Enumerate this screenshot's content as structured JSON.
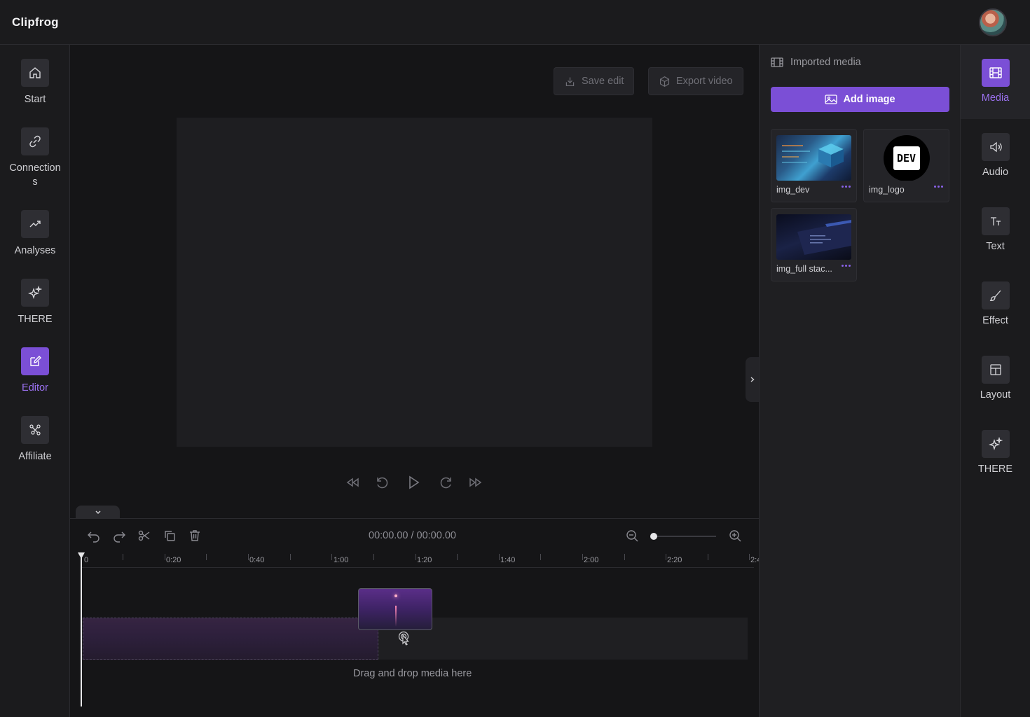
{
  "app": {
    "name": "Clipfrog"
  },
  "left_nav": [
    {
      "label": "Start",
      "icon": "home-icon"
    },
    {
      "label": "Connections",
      "icon": "link-icon"
    },
    {
      "label": "Analyses",
      "icon": "trend-icon"
    },
    {
      "label": "THERE",
      "icon": "sparkle-icon"
    },
    {
      "label": "Editor",
      "icon": "edit-icon",
      "active": true
    },
    {
      "label": "Affiliate",
      "icon": "network-icon"
    }
  ],
  "stage": {
    "save_label": "Save edit",
    "export_label": "Export video"
  },
  "timeline": {
    "time_readout": "00:00.00 / 00:00.00",
    "ruler_labels": [
      "0",
      "0:20",
      "0:40",
      "1:00",
      "1:20",
      "1:40",
      "2:00",
      "2:20",
      "2:4"
    ],
    "drop_hint": "Drag and drop media here"
  },
  "media_panel": {
    "title": "Imported media",
    "add_label": "Add image",
    "items": [
      {
        "name": "img_dev"
      },
      {
        "name": "img_logo",
        "logo_text": "DEV"
      },
      {
        "name": "img_full stac..."
      }
    ]
  },
  "right_nav": [
    {
      "label": "Media",
      "icon": "film-icon",
      "active": true
    },
    {
      "label": "Audio",
      "icon": "speaker-icon"
    },
    {
      "label": "Text",
      "icon": "text-icon"
    },
    {
      "label": "Effect",
      "icon": "brush-icon"
    },
    {
      "label": "Layout",
      "icon": "layout-icon"
    },
    {
      "label": "THERE",
      "icon": "sparkle-icon"
    }
  ],
  "colors": {
    "accent": "#7b4fd6",
    "accent_text": "#9b71f0",
    "background": "#1b1b1d"
  }
}
